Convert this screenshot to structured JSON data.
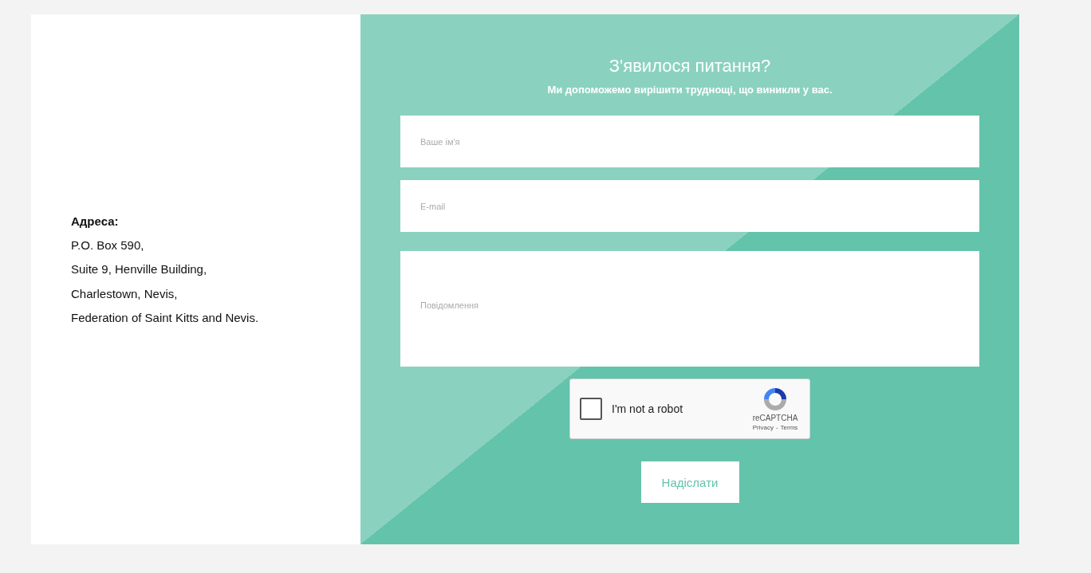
{
  "address": {
    "heading": "Адреса:",
    "lines": [
      "P.O. Box 590,",
      "Suite 9, Henville Building,",
      "Charlestown, Nevis,",
      "Federation of Saint Kitts and Nevis."
    ]
  },
  "form": {
    "title": "З'явилося питання?",
    "subtitle": "Ми допоможемо вирішити труднощі, що виникли у вас.",
    "fields": [
      {
        "kind": "input",
        "placeholder": "Ваше ім'я"
      },
      {
        "kind": "input",
        "placeholder": "E-mail"
      },
      {
        "kind": "textarea",
        "placeholder": "Повідомлення"
      }
    ],
    "captcha": {
      "checked": false,
      "label": "I'm not a robot",
      "brand": "reCAPTCHA",
      "privacy": "Privacy",
      "separator": "-",
      "terms": "Terms"
    },
    "submit": "Надіслати"
  }
}
